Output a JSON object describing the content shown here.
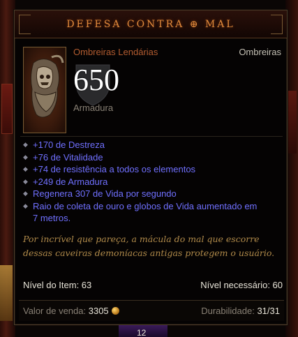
{
  "tooltip": {
    "title": "DEFESA CONTRA ⊕ MAL",
    "item_name": "Ombreiras Lendárias",
    "item_type": "Ombreiras",
    "armor_value": "650",
    "armor_label": "Armadura",
    "stats": [
      "+170 de Destreza",
      "+76 de Vitalidade",
      "+74 de resistência a todos os elementos",
      "+249 de Armadura",
      "Regenera 307 de Vida por segundo",
      "Raio de coleta de ouro e globos de Vida aumentado em",
      "7 metros."
    ],
    "flavor_text": "Por incrível que pareça, a mácula do mal que escorre dessas caveiras demoníacas antigas protegem o usuário.",
    "item_level_label": "Nível do Item: 63",
    "required_level_label": "Nível necessário: 60",
    "sell_value_label": "Valor de venda:",
    "sell_value": "3305",
    "durability_label": "Durabilidade:",
    "durability_value": "31/31"
  },
  "hud": {
    "bottom_number": "12"
  },
  "colors": {
    "legendary": "#b35c30",
    "title": "#e08a3c",
    "magic_stat": "#7070ff",
    "flavor": "#b08a4a"
  },
  "icons": [
    "shoulder-armor-icon",
    "shield-icon",
    "diamond-bullet-icon",
    "gold-coin-icon"
  ]
}
